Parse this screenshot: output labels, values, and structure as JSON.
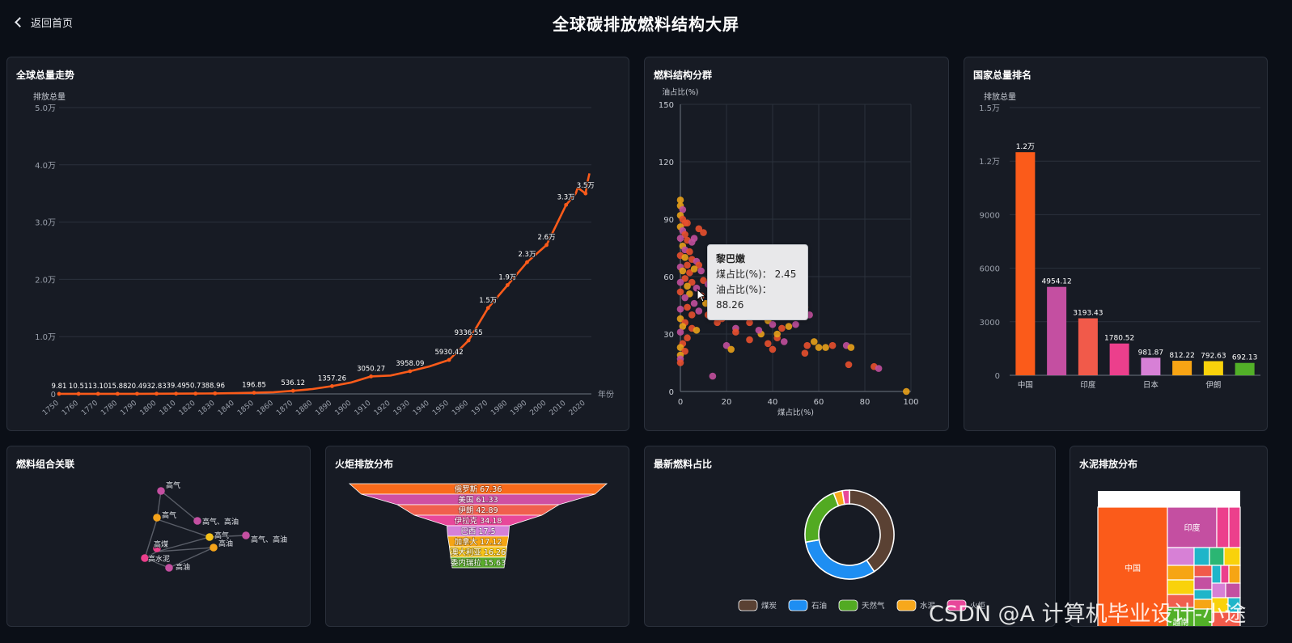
{
  "header": {
    "back_label": "返回首页",
    "title": "全球碳排放燃料结构大屏"
  },
  "panels": {
    "trend": "全球总量走势",
    "scatter": "燃料结构分群",
    "rank": "国家总量排名",
    "graph": "燃料组合关联",
    "funnel": "火炬排放分布",
    "donut": "最新燃料占比",
    "treemap": "水泥排放分布"
  },
  "tooltip": {
    "name": "黎巴嫩",
    "coal_label": "煤占比(%)",
    "coal_value": "2.45",
    "oil_label": "油占比(%)",
    "oil_value": "88.26"
  },
  "watermark": "CSDN @A 计算机毕业设计-小途",
  "colors": {
    "orange": "#fb5b1a",
    "grid": "#2b313c",
    "axis": "#6e7480"
  },
  "chart_data": [
    {
      "type": "line",
      "title": "全球总量走势",
      "ylabel": "排放总量",
      "xlabel": "年份",
      "xlim": [
        1750,
        2023
      ],
      "ylim": [
        0,
        50000
      ],
      "y_ticks": [
        "0",
        "1.0万",
        "2.0万",
        "3.0万",
        "4.0万",
        "5.0万"
      ],
      "x_ticks": [
        "1750",
        "1760",
        "1770",
        "1780",
        "1790",
        "1800",
        "1810",
        "1820",
        "1830",
        "1840",
        "1850",
        "1860",
        "1870",
        "1880",
        "1890",
        "1900",
        "1910",
        "1920",
        "1930",
        "1940",
        "1950",
        "1960",
        "1970",
        "1980",
        "1990",
        "2000",
        "2010",
        "2020"
      ],
      "x": [
        1750,
        1760,
        1770,
        1780,
        1790,
        1800,
        1810,
        1820,
        1830,
        1840,
        1850,
        1860,
        1870,
        1880,
        1890,
        1900,
        1910,
        1920,
        1930,
        1940,
        1950,
        1960,
        1970,
        1980,
        1990,
        2000,
        2010,
        2015,
        2016,
        2020,
        2021,
        2022
      ],
      "y": [
        9.81,
        10.51,
        13.1,
        15.88,
        20.49,
        32.83,
        39.49,
        50.73,
        88.96,
        130,
        196.85,
        300,
        536.12,
        850,
        1357.26,
        2000,
        3050.27,
        3200,
        3958.09,
        4800,
        5930.42,
        9336.55,
        15000,
        19000,
        23000,
        26000,
        33000,
        35000,
        36000,
        35000,
        37000,
        38500
      ],
      "labels": [
        {
          "x": 1750,
          "text": "9.81"
        },
        {
          "x": 1760,
          "text": "10.51"
        },
        {
          "x": 1770,
          "text": "13.10"
        },
        {
          "x": 1780,
          "text": "15.88"
        },
        {
          "x": 1790,
          "text": "20.49"
        },
        {
          "x": 1800,
          "text": "32.83"
        },
        {
          "x": 1810,
          "text": "39.49"
        },
        {
          "x": 1820,
          "text": "50.73"
        },
        {
          "x": 1830,
          "text": "88.96"
        },
        {
          "x": 1850,
          "text": "196.85"
        },
        {
          "x": 1870,
          "text": "536.12"
        },
        {
          "x": 1890,
          "text": "1357.26"
        },
        {
          "x": 1910,
          "text": "3050.27"
        },
        {
          "x": 1930,
          "text": "3958.09"
        },
        {
          "x": 1950,
          "text": "5930.42"
        },
        {
          "x": 1960,
          "text": "9336.55"
        },
        {
          "x": 1970,
          "text": "1.5万"
        },
        {
          "x": 1980,
          "text": "1.9万"
        },
        {
          "x": 1990,
          "text": "2.3万"
        },
        {
          "x": 2000,
          "text": "2.6万"
        },
        {
          "x": 2010,
          "text": "3.3万"
        },
        {
          "x": 2020,
          "text": "3.5万"
        }
      ]
    },
    {
      "type": "scatter",
      "title": "燃料结构分群",
      "xlabel": "煤占比(%)",
      "ylabel": "油占比(%)",
      "xlim": [
        0,
        100
      ],
      "ylim": [
        0,
        150
      ],
      "x_ticks": [
        "0",
        "20",
        "40",
        "60",
        "80",
        "100"
      ],
      "y_ticks": [
        "0",
        "30",
        "60",
        "90",
        "120",
        "150"
      ],
      "points": [
        [
          0,
          100,
          "y"
        ],
        [
          0,
          97,
          "y"
        ],
        [
          1,
          95,
          "p"
        ],
        [
          0,
          92,
          "y"
        ],
        [
          1,
          90,
          "r"
        ],
        [
          2,
          88,
          "r"
        ],
        [
          0,
          86,
          "y"
        ],
        [
          3,
          88,
          "r"
        ],
        [
          1,
          84,
          "p"
        ],
        [
          2,
          82,
          "r"
        ],
        [
          0,
          80,
          "p"
        ],
        [
          3,
          79,
          "r"
        ],
        [
          5,
          78,
          "p"
        ],
        [
          1,
          76,
          "y"
        ],
        [
          2,
          74,
          "p"
        ],
        [
          8,
          85,
          "r"
        ],
        [
          10,
          83,
          "r"
        ],
        [
          6,
          80,
          "p"
        ],
        [
          4,
          73,
          "r"
        ],
        [
          0,
          71,
          "r"
        ],
        [
          2,
          70,
          "y"
        ],
        [
          5,
          69,
          "r"
        ],
        [
          7,
          68,
          "p"
        ],
        [
          3,
          66,
          "r"
        ],
        [
          0,
          65,
          "p"
        ],
        [
          1,
          63,
          "y"
        ],
        [
          4,
          62,
          "r"
        ],
        [
          8,
          66,
          "r"
        ],
        [
          6,
          64,
          "y"
        ],
        [
          9,
          63,
          "p"
        ],
        [
          2,
          59,
          "r"
        ],
        [
          0,
          57,
          "p"
        ],
        [
          5,
          57,
          "r"
        ],
        [
          10,
          58,
          "r"
        ],
        [
          3,
          55,
          "y"
        ],
        [
          7,
          54,
          "p"
        ],
        [
          12,
          56,
          "p"
        ],
        [
          0,
          52,
          "r"
        ],
        [
          4,
          51,
          "y"
        ],
        [
          9,
          50,
          "r"
        ],
        [
          2,
          49,
          "p"
        ],
        [
          14,
          49,
          "r"
        ],
        [
          6,
          46,
          "p"
        ],
        [
          11,
          46,
          "y"
        ],
        [
          3,
          44,
          "r"
        ],
        [
          0,
          43,
          "p"
        ],
        [
          8,
          42,
          "p"
        ],
        [
          5,
          40,
          "r"
        ],
        [
          12,
          40,
          "r"
        ],
        [
          0,
          38,
          "y"
        ],
        [
          2,
          36,
          "r"
        ],
        [
          1,
          34,
          "y"
        ],
        [
          5,
          33,
          "r"
        ],
        [
          7,
          32,
          "y"
        ],
        [
          0,
          31,
          "p"
        ],
        [
          3,
          28,
          "r"
        ],
        [
          1,
          25,
          "r"
        ],
        [
          0,
          23,
          "y"
        ],
        [
          2,
          21,
          "r"
        ],
        [
          0,
          19,
          "y"
        ],
        [
          0,
          17,
          "p"
        ],
        [
          0,
          15,
          "r"
        ],
        [
          14,
          8,
          "p"
        ],
        [
          16,
          36,
          "r"
        ],
        [
          18,
          38,
          "r"
        ],
        [
          20,
          47,
          "y"
        ],
        [
          22,
          40,
          "r"
        ],
        [
          24,
          33,
          "p"
        ],
        [
          26,
          45,
          "r"
        ],
        [
          28,
          40,
          "y"
        ],
        [
          30,
          36,
          "r"
        ],
        [
          32,
          44,
          "r"
        ],
        [
          34,
          39,
          "p"
        ],
        [
          35,
          30,
          "y"
        ],
        [
          37,
          46,
          "r"
        ],
        [
          38,
          37,
          "y"
        ],
        [
          40,
          35,
          "p"
        ],
        [
          42,
          28,
          "r"
        ],
        [
          44,
          33,
          "r"
        ],
        [
          46,
          48,
          "y"
        ],
        [
          48,
          42,
          "r"
        ],
        [
          50,
          35,
          "p"
        ],
        [
          20,
          24,
          "p"
        ],
        [
          22,
          22,
          "y"
        ],
        [
          24,
          31,
          "r"
        ],
        [
          30,
          27,
          "r"
        ],
        [
          34,
          32,
          "p"
        ],
        [
          38,
          25,
          "r"
        ],
        [
          40,
          22,
          "r"
        ],
        [
          42,
          30,
          "y"
        ],
        [
          45,
          26,
          "p"
        ],
        [
          47,
          34,
          "y"
        ],
        [
          52,
          40,
          "r"
        ],
        [
          54,
          44,
          "r"
        ],
        [
          56,
          40,
          "p"
        ],
        [
          55,
          24,
          "r"
        ],
        [
          58,
          26,
          "y"
        ],
        [
          54,
          20,
          "r"
        ],
        [
          60,
          23,
          "y"
        ],
        [
          63,
          23,
          "y"
        ],
        [
          66,
          24,
          "r"
        ],
        [
          72,
          24,
          "p"
        ],
        [
          74,
          23,
          "y"
        ],
        [
          73,
          14,
          "r"
        ],
        [
          84,
          13,
          "r"
        ],
        [
          86,
          12,
          "p"
        ],
        [
          98,
          0,
          "y"
        ],
        [
          30,
          62,
          "r"
        ],
        [
          26,
          58,
          "p"
        ],
        [
          36,
          56,
          "y"
        ],
        [
          44,
          50,
          "r"
        ],
        [
          16,
          70,
          "r"
        ],
        [
          18,
          62,
          "p"
        ],
        [
          34,
          66,
          "r"
        ]
      ]
    },
    {
      "type": "bar",
      "title": "国家总量排名",
      "ylabel": "排放总量",
      "ylim": [
        0,
        15000
      ],
      "y_ticks": [
        "0",
        "3000",
        "6000",
        "9000",
        "1.2万",
        "1.5万"
      ],
      "categories": [
        "中国",
        "",
        "印度",
        "",
        "日本",
        "",
        "伊朗",
        ""
      ],
      "values": [
        12500,
        4954.12,
        3193.43,
        1780.52,
        981.87,
        812.22,
        792.63,
        692.13
      ],
      "value_labels": [
        "1.2万",
        "4954.12",
        "3193.43",
        "1780.52",
        "981.87",
        "812.22",
        "792.63",
        "692.13"
      ],
      "colors": [
        "#fb5b1a",
        "#c44fa1",
        "#f15a4a",
        "#ec3f8c",
        "#d780d6",
        "#f8a414",
        "#f9d20b",
        "#52b028"
      ]
    },
    {
      "type": "funnel",
      "title": "火炬排放分布",
      "items": [
        {
          "name": "俄罗斯",
          "value": 67.36,
          "color": "#f96a1a"
        },
        {
          "name": "美国",
          "value": 61.33,
          "color": "#cf4fa2"
        },
        {
          "name": "伊朗",
          "value": 42.89,
          "color": "#f05f4e"
        },
        {
          "name": "伊拉克",
          "value": 34.18,
          "color": "#e8479a"
        },
        {
          "name": "巴西",
          "value": 17.5,
          "color": "#d580d8"
        },
        {
          "name": "加拿大",
          "value": 17.12,
          "color": "#f6a514"
        },
        {
          "name": "澳大利亚",
          "value": 16.26,
          "color": "#f6c419"
        },
        {
          "name": "委内瑞拉",
          "value": 15.63,
          "color": "#5aac2c"
        }
      ]
    },
    {
      "type": "pie",
      "title": "最新燃料占比",
      "slices": [
        {
          "name": "煤炭",
          "value": 40.6,
          "color": "#5a4133"
        },
        {
          "name": "石油",
          "value": 31.7,
          "color": "#1e8ef2"
        },
        {
          "name": "天然气",
          "value": 21.9,
          "color": "#52aa22"
        },
        {
          "name": "水泥",
          "value": 3.2,
          "color": "#f7a81c"
        },
        {
          "name": "火炬",
          "value": 2.6,
          "color": "#e8479a"
        }
      ]
    },
    {
      "type": "treemap",
      "title": "水泥排放分布",
      "labels": [
        "中国",
        "印度",
        "越南"
      ]
    }
  ],
  "graph_nodes": [
    "高气",
    "高气",
    "高油",
    "高气",
    "高煤",
    "高油",
    "高水泥",
    "高气、高油",
    "高气、高油"
  ]
}
